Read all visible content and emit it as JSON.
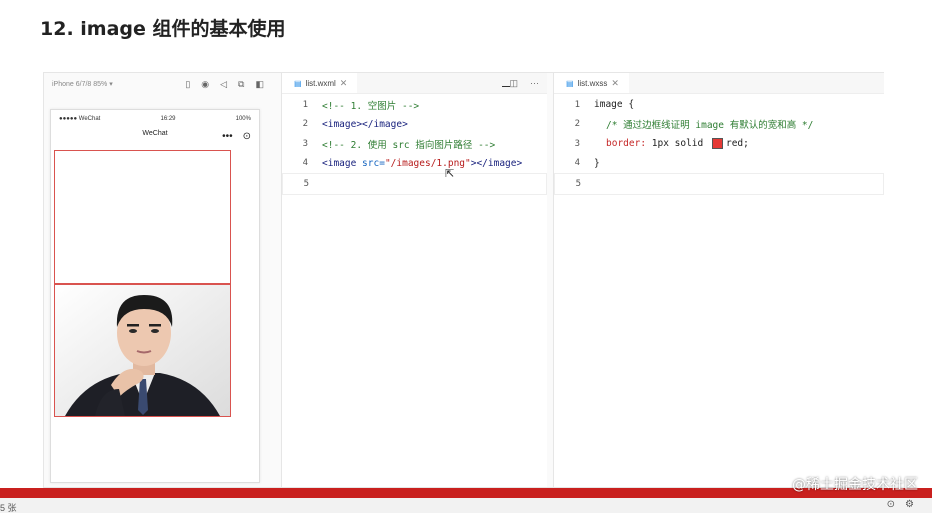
{
  "slide": {
    "title": "12. image 组件的基本使用"
  },
  "simulator": {
    "device": "iPhone 6/7/8 85% ▾",
    "status": {
      "signal": "●●●●● WeChat",
      "time": "16:29",
      "battery": "100%"
    },
    "nav_title": "WeChat"
  },
  "left_editor": {
    "tab_label": "list.wxml",
    "lines": [
      {
        "n": "1",
        "comment": "<!-- 1. 空图片 -->"
      },
      {
        "n": "2",
        "tag": "<image></image>"
      },
      {
        "n": "3",
        "comment": "<!-- 2. 使用 src 指向图片路径 -->"
      },
      {
        "n": "4",
        "tag_open": "<image ",
        "attr": "src=",
        "str": "\"/images/1.png\"",
        "tag_close": "></image>"
      },
      {
        "n": "5"
      }
    ]
  },
  "right_editor": {
    "tab_label": "list.wxss",
    "lines": [
      {
        "n": "1",
        "selector": "image {"
      },
      {
        "n": "2",
        "comment": "/* 通过边框线证明 image 有默认的宽和高 */"
      },
      {
        "n": "3",
        "prop": "border:",
        "value_pre": " 1px solid ",
        "value_color": "red;"
      },
      {
        "n": "4",
        "selector": "}"
      },
      {
        "n": "5"
      }
    ],
    "swatch_color": "#e53935"
  },
  "footer": {
    "left_text": "5 张"
  },
  "watermark": "@稀土掘金技术社区"
}
